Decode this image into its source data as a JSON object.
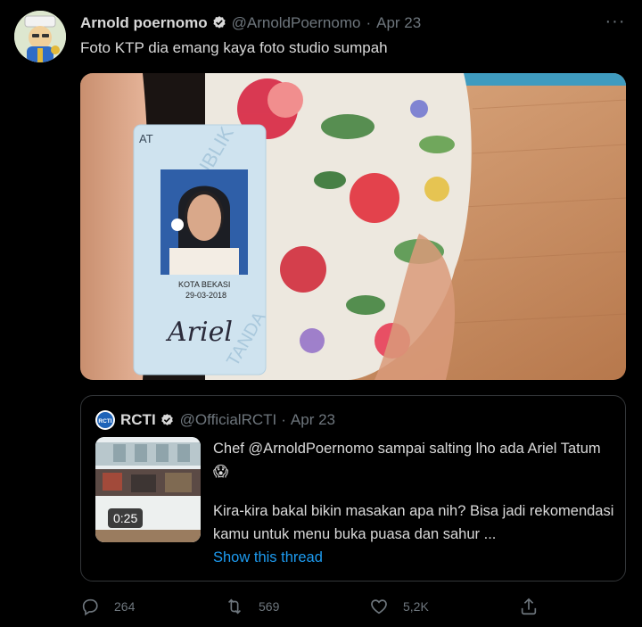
{
  "tweet": {
    "author_name": "Arnold poernomo",
    "handle": "@ArnoldPoernomo",
    "separator": "·",
    "date": "Apr 23",
    "more": "···",
    "text": "Foto KTP dia emang kaya foto studio sumpah"
  },
  "id_card": {
    "partial_label": "AT",
    "city": "KOTA BEKASI",
    "date": "29-03-2018",
    "signature": "Ariel"
  },
  "quote": {
    "author_name": "RCTI",
    "logo_text": "RCTI",
    "handle": "@OfficialRCTI",
    "separator": "·",
    "date": "Apr 23",
    "text_line1": "Chef @ArnoldPoernomo sampai salting lho ada Ariel Tatum 😱",
    "text_line2": "Kira-kira bakal bikin masakan apa nih? Bisa jadi rekomendasi kamu untuk menu buka puasa dan sahur ...",
    "video_duration": "0:25",
    "show_thread": "Show this thread"
  },
  "actions": {
    "replies": "264",
    "retweets": "569",
    "likes": "5,2K"
  },
  "colors": {
    "background": "#000000",
    "text": "#d9d9d9",
    "muted": "#6e767d",
    "link": "#1d9bf0",
    "verified": "#d9d9d9"
  },
  "icons": {
    "reply": "reply-icon",
    "retweet": "retweet-icon",
    "like": "heart-icon",
    "share": "share-icon",
    "verified": "verified-badge-icon",
    "more": "more-icon"
  }
}
